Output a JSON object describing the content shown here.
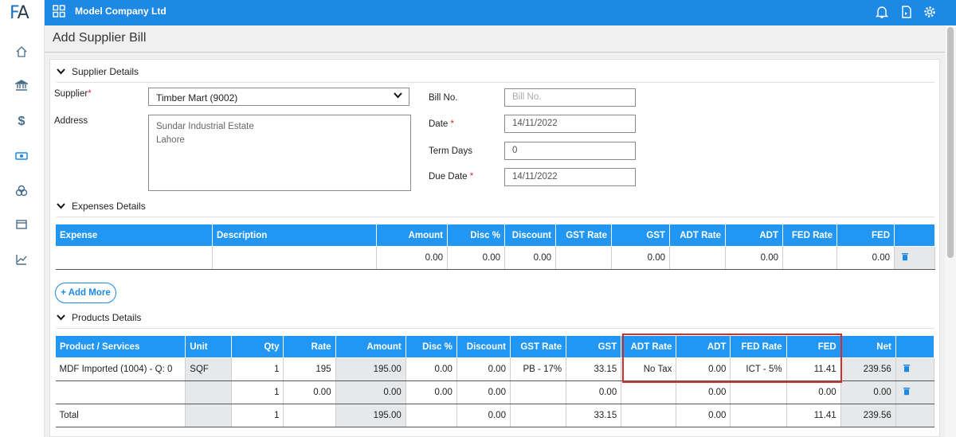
{
  "app": {
    "logo_f": "F",
    "logo_a": "A",
    "company": "Model Company Ltd"
  },
  "page": {
    "title": "Add Supplier Bill"
  },
  "sections": {
    "supplier": "Supplier Details",
    "expenses": "Expenses Details",
    "products": "Products Details"
  },
  "supplier": {
    "supplier_label": "Supplier",
    "supplier_value": "Timber Mart (9002)",
    "address_label": "Address",
    "address_line1": "Sundar Industrial Estate",
    "address_line2": "Lahore",
    "bill_no_label": "Bill No.",
    "bill_no_placeholder": "Bill No.",
    "date_label": "Date",
    "date_value": "14/11/2022",
    "term_days_label": "Term Days",
    "term_days_value": "0",
    "due_date_label": "Due Date",
    "due_date_value": "14/11/2022",
    "req_mark": "*"
  },
  "expenses": {
    "headers": [
      "Expense",
      "Description",
      "Amount",
      "Disc %",
      "Discount",
      "GST Rate",
      "GST",
      "ADT Rate",
      "ADT",
      "FED Rate",
      "FED"
    ],
    "row": [
      "",
      "",
      "0.00",
      "0.00",
      "0.00",
      "",
      "0.00",
      "",
      "0.00",
      "",
      "0.00"
    ],
    "add_more": "+ Add More"
  },
  "products": {
    "headers": [
      "Product / Services",
      "Unit",
      "Qty",
      "Rate",
      "Amount",
      "Disc %",
      "Discount",
      "GST Rate",
      "GST",
      "ADT Rate",
      "ADT",
      "FED Rate",
      "FED",
      "Net"
    ],
    "rows": [
      [
        "MDF Imported (1004) - Q: 0",
        "SQF",
        "1",
        "195",
        "195.00",
        "0.00",
        "0.00",
        "PB - 17%",
        "33.15",
        "No Tax",
        "0.00",
        "ICT - 5%",
        "11.41",
        "239.56"
      ],
      [
        "",
        "",
        "1",
        "0.00",
        "0.00",
        "0.00",
        "0.00",
        "",
        "0.00",
        "",
        "0.00",
        "",
        "0.00",
        "0.00"
      ]
    ],
    "total": [
      "Total",
      "",
      "1",
      "",
      "195.00",
      "",
      "0.00",
      "",
      "33.15",
      "",
      "0.00",
      "",
      "11.41",
      "239.56"
    ]
  },
  "icons": {
    "sidebar": [
      "home-icon",
      "bank-icon",
      "dollar-icon",
      "cash-icon",
      "coins-icon",
      "window-icon",
      "chart-icon"
    ],
    "topbar": [
      "grid-icon",
      "bell-icon",
      "report-icon",
      "gear-icon"
    ]
  },
  "colors": {
    "primary": "#1e88e5",
    "header": "#2196f3",
    "highlight": "#d32f2f"
  }
}
